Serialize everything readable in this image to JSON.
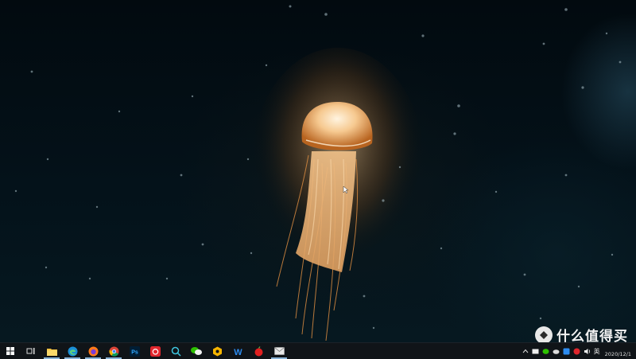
{
  "desktop": {
    "wallpaper": "jellyfish-deep-sea",
    "accent": "#f0b878"
  },
  "taskbar": {
    "background": "#101418",
    "items": [
      {
        "name": "start-button",
        "icon": "windows-icon"
      },
      {
        "name": "task-view-button",
        "icon": "task-view-icon"
      },
      {
        "name": "file-explorer-button",
        "icon": "folder-icon",
        "active": true
      },
      {
        "name": "edge-button",
        "icon": "edge-icon",
        "active": true
      },
      {
        "name": "firefox-button",
        "icon": "firefox-icon",
        "active": true
      },
      {
        "name": "chrome-button",
        "icon": "chrome-icon",
        "active": true
      },
      {
        "name": "photoshop-button",
        "icon": "photoshop-icon",
        "label": "Ps"
      },
      {
        "name": "netease-music-button",
        "icon": "netease-icon"
      },
      {
        "name": "search-app-button",
        "icon": "magnifier-icon"
      },
      {
        "name": "wechat-button",
        "icon": "wechat-icon"
      },
      {
        "name": "hex-app-button",
        "icon": "hexagon-icon"
      },
      {
        "name": "wps-button",
        "icon": "wps-icon",
        "label": "W"
      },
      {
        "name": "red-app-button",
        "icon": "apple-icon"
      },
      {
        "name": "mail-button",
        "icon": "mail-icon",
        "active": true
      }
    ]
  },
  "tray": {
    "ime_label": "英",
    "date": "2020/12/1"
  },
  "watermark": {
    "text": "什么值得买",
    "logo_text": "值"
  }
}
